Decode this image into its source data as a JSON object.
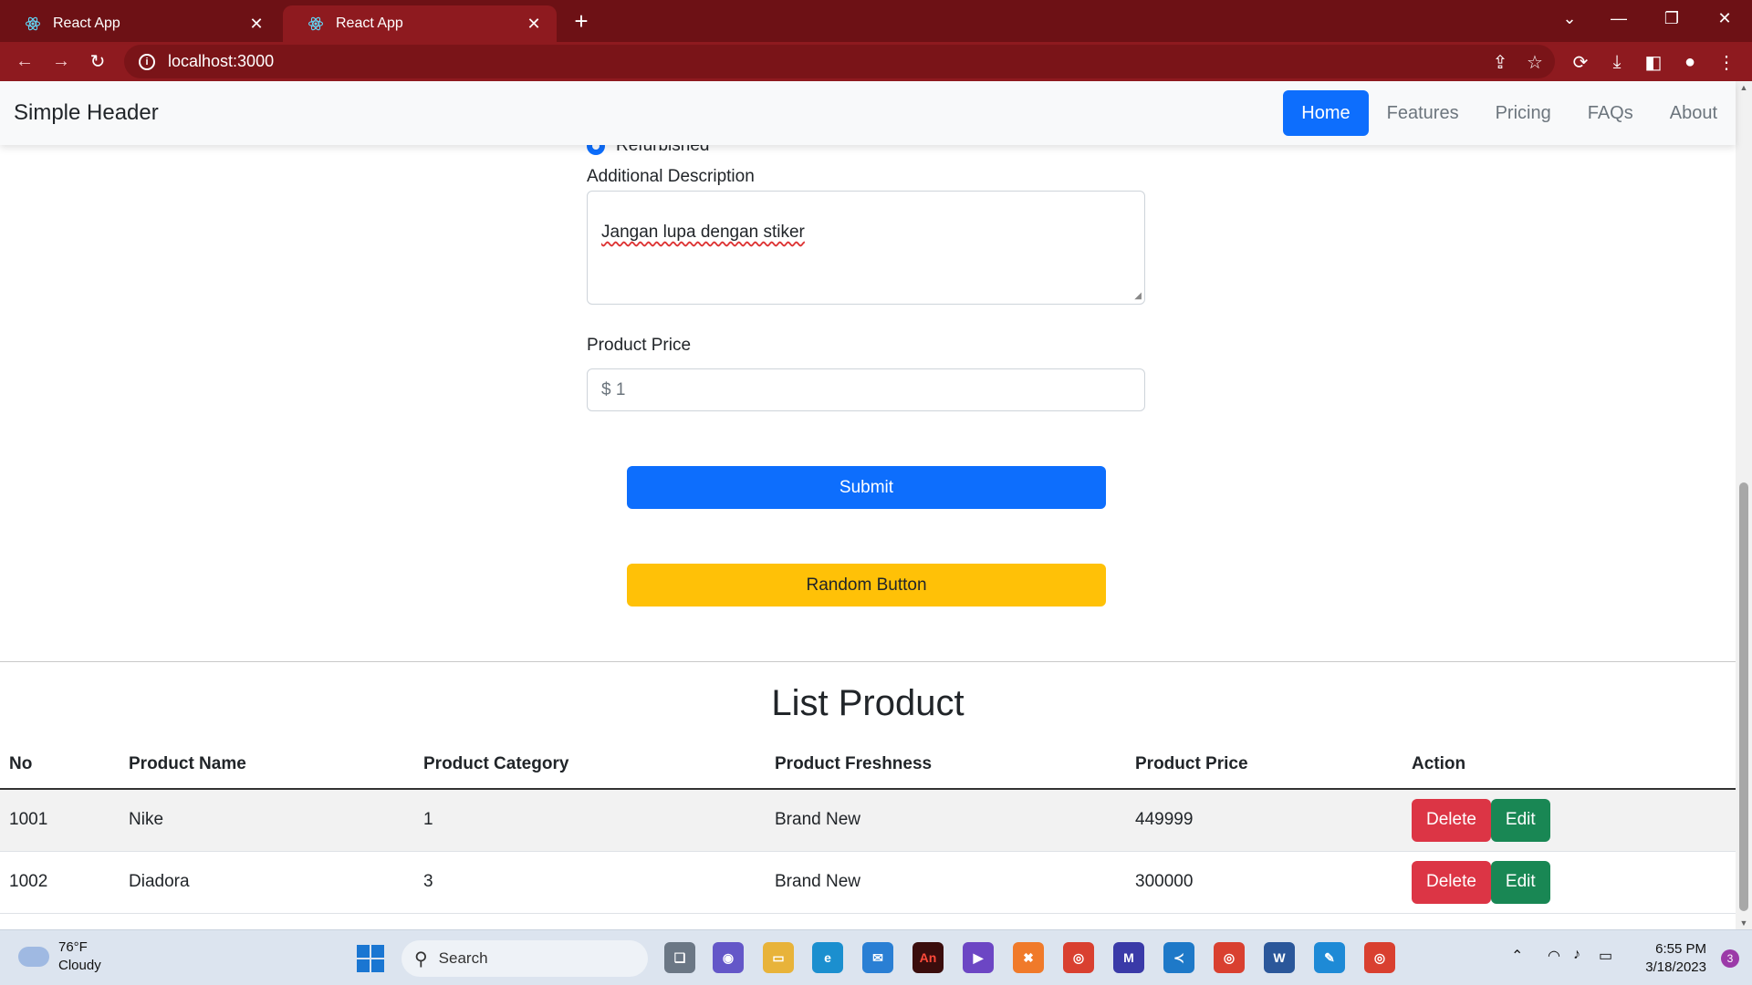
{
  "browser": {
    "tabs": [
      {
        "title": "React App",
        "active": false
      },
      {
        "title": "React App",
        "active": true
      }
    ],
    "address": "localhost:3000",
    "colors": {
      "frame": "#6d1115",
      "toolbar": "#8e1a1f"
    }
  },
  "navbar": {
    "brand": "Simple Header",
    "links": [
      {
        "label": "Home",
        "active": true
      },
      {
        "label": "Features",
        "active": false
      },
      {
        "label": "Pricing",
        "active": false
      },
      {
        "label": "FAQs",
        "active": false
      },
      {
        "label": "About",
        "active": false
      }
    ]
  },
  "form": {
    "freshness_option": "Refurbished",
    "description_label": "Additional Description",
    "description_value": "Jangan lupa dengan stiker",
    "price_label": "Product Price",
    "price_value": "$ 1",
    "submit_label": "Submit",
    "random_label": "Random Button"
  },
  "list": {
    "title": "List Product",
    "columns": [
      "No",
      "Product Name",
      "Product Category",
      "Product Freshness",
      "Product Price",
      "Action"
    ],
    "rows": [
      {
        "no": "1001",
        "name": "Nike",
        "category": "1",
        "freshness": "Brand New",
        "price": "449999"
      },
      {
        "no": "1002",
        "name": "Diadora",
        "category": "3",
        "freshness": "Brand New",
        "price": "300000"
      }
    ],
    "delete_label": "Delete",
    "edit_label": "Edit"
  },
  "taskbar": {
    "weather_temp": "76°F",
    "weather_desc": "Cloudy",
    "search_label": "Search",
    "time": "6:55 PM",
    "date": "3/18/2023",
    "notifications": "3"
  }
}
